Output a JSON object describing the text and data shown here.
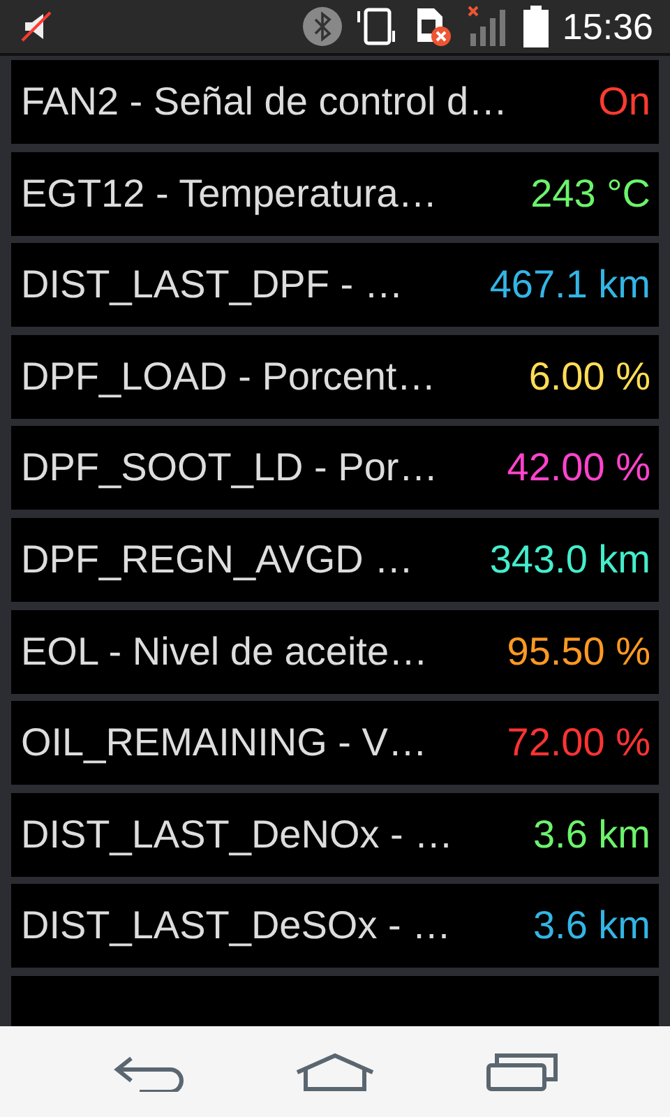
{
  "status_bar": {
    "time": "15:36"
  },
  "rows": [
    {
      "name": "FAN2 - Señal de control d…",
      "value": "On",
      "color": "#ff3b30"
    },
    {
      "name": "EGT12 - Temperatura…",
      "value": "243 °C",
      "color": "#6cf36c"
    },
    {
      "name": "DIST_LAST_DPF - …",
      "value": "467.1 km",
      "color": "#33b5e5"
    },
    {
      "name": "DPF_LOAD - Porcent…",
      "value": "6.00 %",
      "color": "#ffdd55"
    },
    {
      "name": "DPF_SOOT_LD - Por…",
      "value": "42.00 %",
      "color": "#ff44cc"
    },
    {
      "name": "DPF_REGN_AVGD …",
      "value": "343.0 km",
      "color": "#44eecc"
    },
    {
      "name": "EOL - Nivel de aceite…",
      "value": "95.50 %",
      "color": "#ff9922"
    },
    {
      "name": "OIL_REMAINING - V…",
      "value": "72.00 %",
      "color": "#ff3333"
    },
    {
      "name": "DIST_LAST_DeNOx - …",
      "value": "3.6 km",
      "color": "#6cf36c"
    },
    {
      "name": "DIST_LAST_DeSOx - …",
      "value": "3.6 km",
      "color": "#33b5e5"
    }
  ]
}
